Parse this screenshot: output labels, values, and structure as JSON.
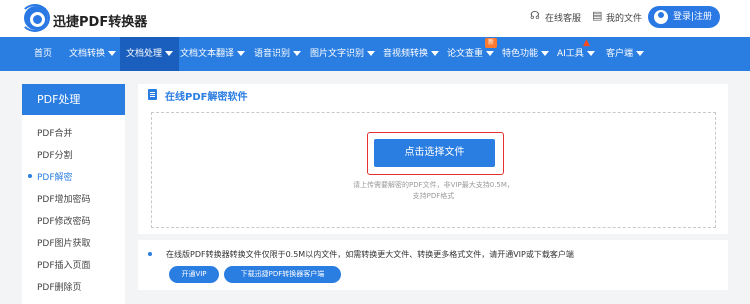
{
  "header": {
    "brand": "迅捷PDF转换器",
    "service_label": "在线客服",
    "files_label": "我的文件",
    "login_label": "登录|注册"
  },
  "nav": {
    "items": [
      {
        "label": "首页",
        "has_caret": false
      },
      {
        "label": "文档转换",
        "has_caret": true
      },
      {
        "label": "文档处理",
        "has_caret": true,
        "active": true
      },
      {
        "label": "文档文本翻译",
        "has_caret": true
      },
      {
        "label": "语音识别",
        "has_caret": true
      },
      {
        "label": "图片文字识别",
        "has_caret": true
      },
      {
        "label": "音视频转换",
        "has_caret": true
      },
      {
        "label": "论文查重",
        "has_caret": true
      },
      {
        "label": "特色功能",
        "has_caret": true
      },
      {
        "label": "AI工具",
        "has_caret": true
      },
      {
        "label": "客户端",
        "has_caret": true
      }
    ],
    "badge_new": "新"
  },
  "sidebar": {
    "title": "PDF处理",
    "items": [
      {
        "label": "PDF合并"
      },
      {
        "label": "PDF分割"
      },
      {
        "label": "PDF解密",
        "active": true
      },
      {
        "label": "PDF增加密码"
      },
      {
        "label": "PDF修改密码"
      },
      {
        "label": "PDF图片获取"
      },
      {
        "label": "PDF插入页面"
      },
      {
        "label": "PDF删除页"
      }
    ]
  },
  "main": {
    "title": "在线PDF解密软件",
    "upload_button": "点击选择文件",
    "hint_line1": "请上传需要解密的PDF文件，非VIP最大支持0.5M，",
    "hint_line2": "支持PDF格式"
  },
  "notice": {
    "text": "在线版PDF转换器转换文件仅限于0.5M以内文件，如需转换更大文件、转换更多格式文件，请开通VIP或下载客户端",
    "vip_button": "开通VIP",
    "download_button": "下载迅捷PDF转换器客户端"
  },
  "colors": {
    "primary": "#2a7de1",
    "nav_active": "#1a5fbe",
    "highlight_box": "#e53030",
    "badge": "#ff7a2e"
  }
}
